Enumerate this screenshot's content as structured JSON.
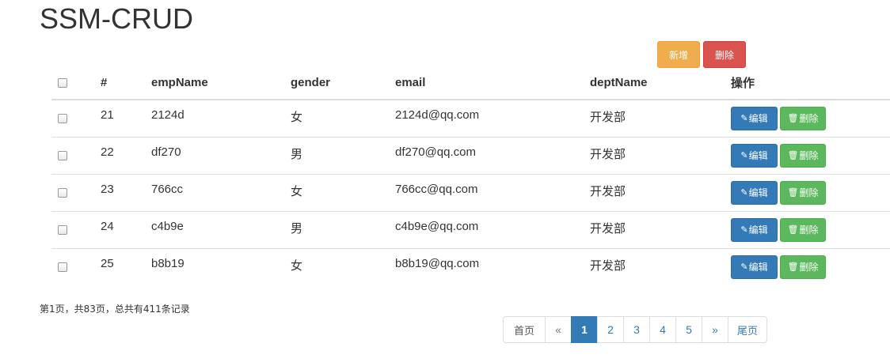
{
  "header": {
    "title": "SSM-CRUD"
  },
  "actions": {
    "add_label": "新增",
    "delete_label": "删除"
  },
  "table": {
    "columns": [
      "#",
      "empName",
      "gender",
      "email",
      "deptName",
      "操作"
    ],
    "rows": [
      {
        "id": "21",
        "empName": "2124d",
        "gender": "女",
        "email": "2124d@qq.com",
        "deptName": "开发部"
      },
      {
        "id": "22",
        "empName": "df270",
        "gender": "男",
        "email": "df270@qq.com",
        "deptName": "开发部"
      },
      {
        "id": "23",
        "empName": "766cc",
        "gender": "女",
        "email": "766cc@qq.com",
        "deptName": "开发部"
      },
      {
        "id": "24",
        "empName": "c4b9e",
        "gender": "男",
        "email": "c4b9e@qq.com",
        "deptName": "开发部"
      },
      {
        "id": "25",
        "empName": "b8b19",
        "gender": "女",
        "email": "b8b19@qq.com",
        "deptName": "开发部"
      }
    ],
    "row_actions": {
      "edit_label": "编辑",
      "delete_label": "删除",
      "edit_icon": "pencil-icon",
      "delete_icon": "trash-icon"
    }
  },
  "pagination": {
    "info": "第1页，共83页，总共有411条记录",
    "first": "首页",
    "prev": "«",
    "pages": [
      "1",
      "2",
      "3",
      "4",
      "5"
    ],
    "current": "1",
    "next": "»",
    "last": "尾页"
  },
  "colors": {
    "primary": "#337ab7",
    "success": "#5cb85c",
    "warning": "#f0ad4e",
    "danger": "#d9534f"
  }
}
